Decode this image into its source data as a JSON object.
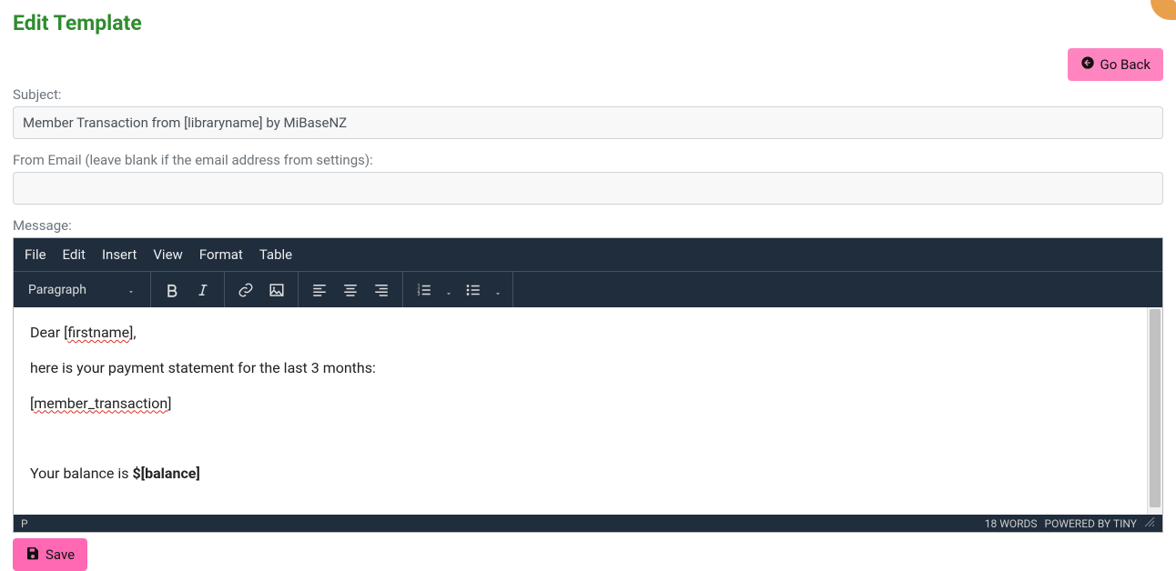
{
  "page": {
    "title": "Edit Template",
    "go_back_label": "Go Back",
    "save_label": "Save"
  },
  "form": {
    "subject_label": "Subject:",
    "subject_value": "Member Transaction from [libraryname] by MiBaseNZ",
    "from_email_label": "From Email (leave blank if the email address from settings):",
    "from_email_value": "",
    "message_label": "Message:"
  },
  "editor": {
    "menu": {
      "file": "File",
      "edit": "Edit",
      "insert": "Insert",
      "view": "View",
      "format": "Format",
      "table": "Table"
    },
    "toolbar": {
      "format_select": "Paragraph"
    },
    "body": {
      "greeting_prefix": "Dear [",
      "greeting_name": "firstname",
      "greeting_suffix": "],",
      "line2": "here is your payment statement for the last 3 months:",
      "token_prefix": "[",
      "token_text": "member_transaction",
      "token_suffix": "]",
      "balance_prefix": "Your balance is ",
      "balance_token": "$[balance]"
    },
    "status": {
      "path": "P",
      "words": "18 WORDS",
      "powered": "POWERED BY TINY"
    }
  }
}
